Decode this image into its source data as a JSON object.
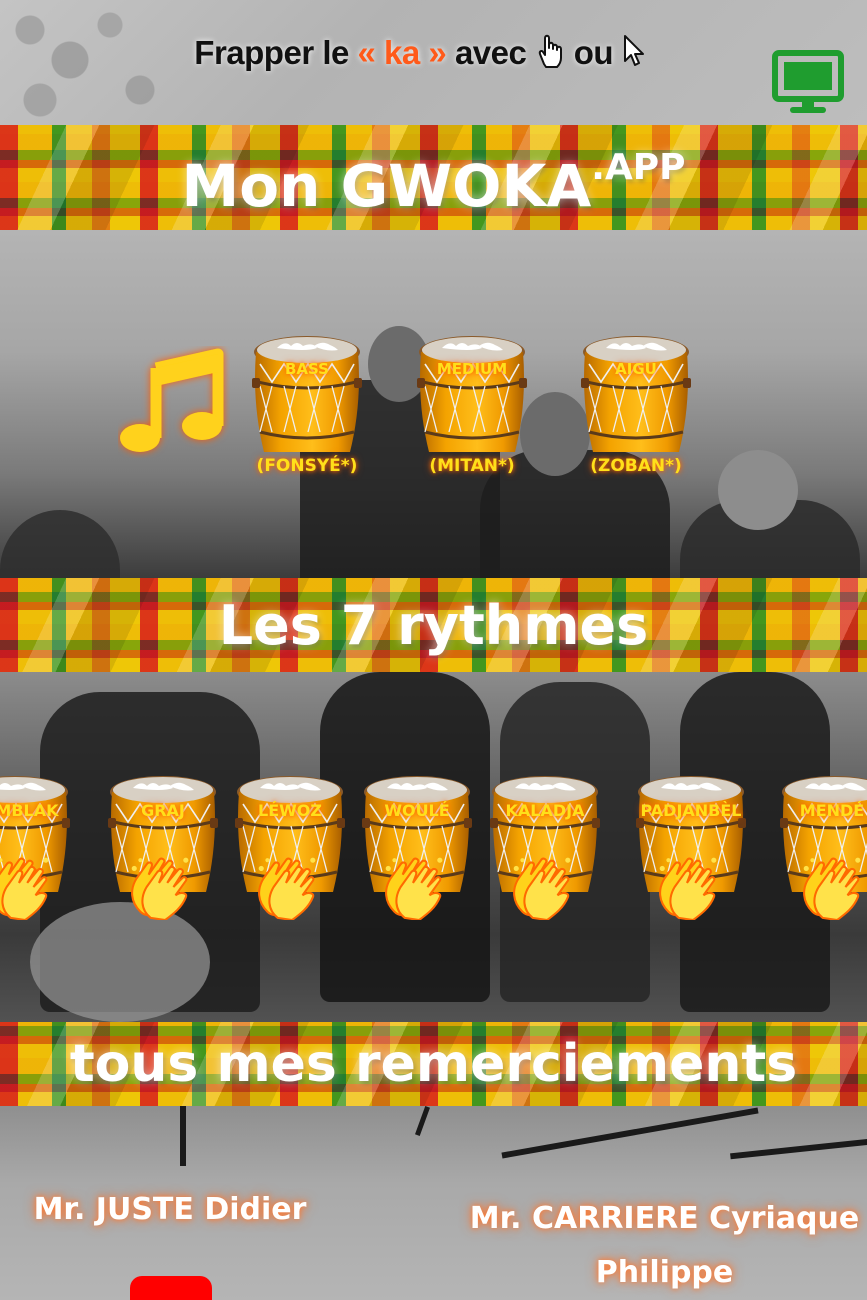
{
  "header": {
    "instruction_prefix": "Frapper le ",
    "instruction_ka": "« ka »",
    "instruction_mid": " avec ",
    "instruction_or": " ou ",
    "screen_icon": "desktop-icon"
  },
  "app_banner": {
    "title": "Mon GWOKA",
    "suffix": ".APP"
  },
  "drums": [
    {
      "name": "BASS",
      "sub": "(FONSYÉ*)"
    },
    {
      "name": "MEDIUM",
      "sub": "(MITAN*)"
    },
    {
      "name": "AIGU",
      "sub": "(ZOBAN*)"
    }
  ],
  "rhythms_banner": {
    "title": "Les 7 rythmes"
  },
  "rhythms": [
    {
      "name": "TUMBLAK"
    },
    {
      "name": "GRAJ"
    },
    {
      "name": "LÉWOZ"
    },
    {
      "name": "WOULÉ"
    },
    {
      "name": "KALADJA"
    },
    {
      "name": "PADJANBÈL"
    },
    {
      "name": "MENDÉ"
    }
  ],
  "thanks_banner": {
    "title": "tous mes remerciements"
  },
  "thanks": {
    "person1": "Mr. JUSTE Didier",
    "person2": "Mr. CARRIERE Cyriaque Philippe"
  },
  "colors": {
    "accent": "#ff5a1a",
    "drum_label": "#ffe01a",
    "screen_icon": "#1f9d2f",
    "youtube": "#ff0000"
  }
}
